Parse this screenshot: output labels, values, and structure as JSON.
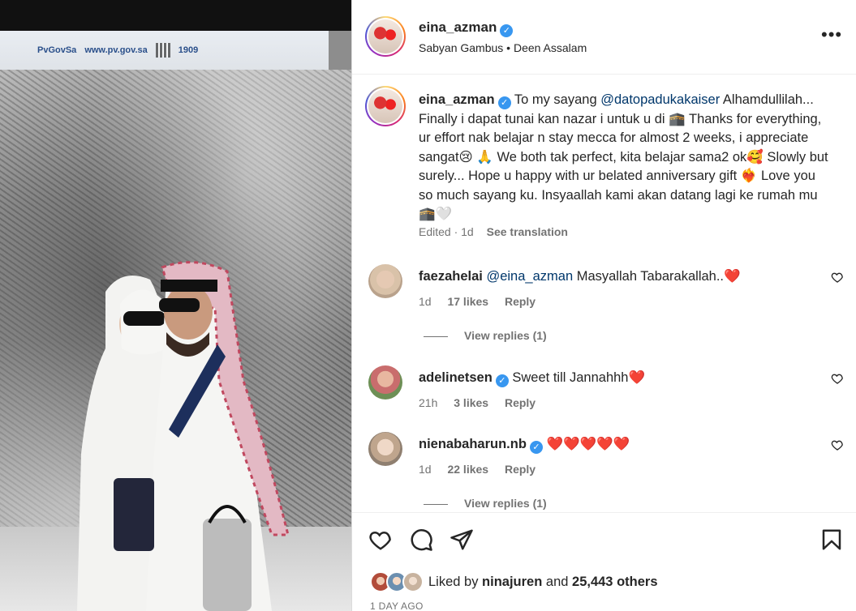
{
  "post": {
    "author": "eina_azman",
    "audio": "Sabyan Gambus • Deen Assalam",
    "banner": {
      "handle": "PvGovSa",
      "website": "www.pv.gov.sa",
      "hotline": "1909"
    }
  },
  "caption": {
    "username": "eina_azman",
    "lead": " To my sayang ",
    "mention": "@datopadukakaiser",
    "text": " Alhamdullilah... Finally i dapat tunai kan nazar i untuk u di 🕋 Thanks for everything, ur effort nak belajar n stay mecca for almost 2 weeks, i appreciate sangat😢 🙏 We both tak perfect, kita belajar sama2 ok🥰 Slowly but surely... Hope u happy with ur belated anniversary gift ❤️‍🔥 Love you so much sayang ku. Insyaallah kami akan datang lagi ke rumah mu🕋🤍",
    "edited_time": "Edited · 1d",
    "see_translation": "See translation"
  },
  "comments": [
    {
      "username": "faezahelai",
      "verified": false,
      "mention": "@eina_azman",
      "text": " Masyallah Tabarakallah..",
      "emoji": "❤️",
      "time": "1d",
      "likes": "17 likes",
      "reply": "Reply",
      "view_replies": "View replies (1)"
    },
    {
      "username": "adelinetsen",
      "verified": true,
      "mention": "",
      "text": " Sweet till Jannahhh",
      "emoji": "❤️",
      "time": "21h",
      "likes": "3 likes",
      "reply": "Reply",
      "view_replies": ""
    },
    {
      "username": "nienabaharun.nb",
      "verified": true,
      "mention": "",
      "text": " ",
      "emoji": "❤️❤️❤️❤️❤️",
      "time": "1d",
      "likes": "22 likes",
      "reply": "Reply",
      "view_replies": "View replies (1)"
    }
  ],
  "likes_bar": {
    "liked_by_prefix": "Liked by ",
    "liked_by_user": "ninajuren",
    "and": " and ",
    "others": "25,443 others",
    "date": "1 DAY AGO"
  },
  "icons": [
    "more-icon",
    "heart-icon",
    "comment-icon",
    "share-icon",
    "bookmark-icon",
    "verified-icon"
  ],
  "colors": {
    "verified": "#3897f0",
    "mention": "#00376b",
    "secondary_text": "#737373",
    "heart_red": "#ed1c24"
  }
}
